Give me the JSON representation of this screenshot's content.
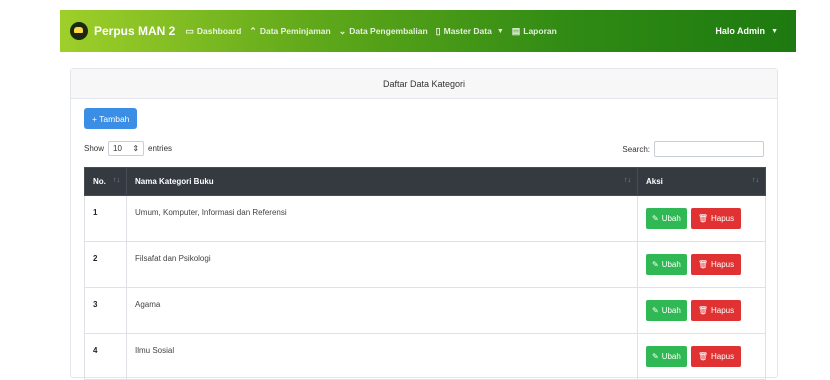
{
  "navbar": {
    "brand": "Perpus MAN 2",
    "items": [
      {
        "label": "Dashboard",
        "icon": "monitor-icon"
      },
      {
        "label": "Data Peminjaman",
        "icon": "arrow-up-icon"
      },
      {
        "label": "Data Pengembalian",
        "icon": "arrow-down-icon"
      },
      {
        "label": "Master Data",
        "icon": "folder-icon"
      },
      {
        "label": "Laporan",
        "icon": "file-icon"
      }
    ],
    "user": "Halo Admin"
  },
  "card": {
    "title": "Daftar Data Kategori",
    "add_button": "+ Tambah",
    "show_label": "Show",
    "entries_value": "10",
    "entries_label": "entries",
    "search_label": "Search:"
  },
  "table": {
    "headers": [
      "No.",
      "Nama Kategori Buku",
      "Aksi"
    ],
    "rows": [
      {
        "no": "1",
        "nama": "Umum, Komputer, Informasi dan Referensi"
      },
      {
        "no": "2",
        "nama": "Filsafat dan Psikologi"
      },
      {
        "no": "3",
        "nama": "Agama"
      },
      {
        "no": "4",
        "nama": "Ilmu Sosial"
      }
    ],
    "edit_label": "Ubah",
    "delete_label": "Hapus"
  },
  "colors": {
    "add_button": "#3a8ee6",
    "edit_button": "#2fb853",
    "delete_button": "#e03232",
    "table_header": "#343a40"
  }
}
